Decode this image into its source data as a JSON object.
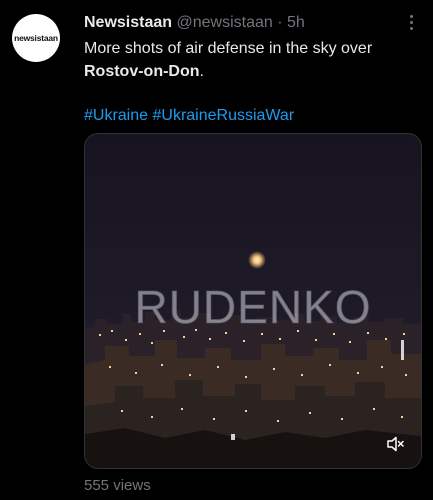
{
  "tweet": {
    "avatar_text": "newsistaan",
    "name": "Newsistaan",
    "handle": "@newsistaan",
    "separator": "·",
    "time": "5h",
    "text_part1": "More shots of air defense in the sky over ",
    "text_bold": "Rostov-on-Don",
    "text_part2": ".",
    "hashtags": [
      "#Ukraine",
      "#UkraineRussiaWar"
    ],
    "media": {
      "watermark": "RUDENKO",
      "mute_icon": "speaker-muted-icon"
    },
    "views": "555 views"
  },
  "colors": {
    "background": "#000000",
    "text": "#e7e9ea",
    "secondary": "#71767b",
    "link": "#1d9bf0"
  }
}
